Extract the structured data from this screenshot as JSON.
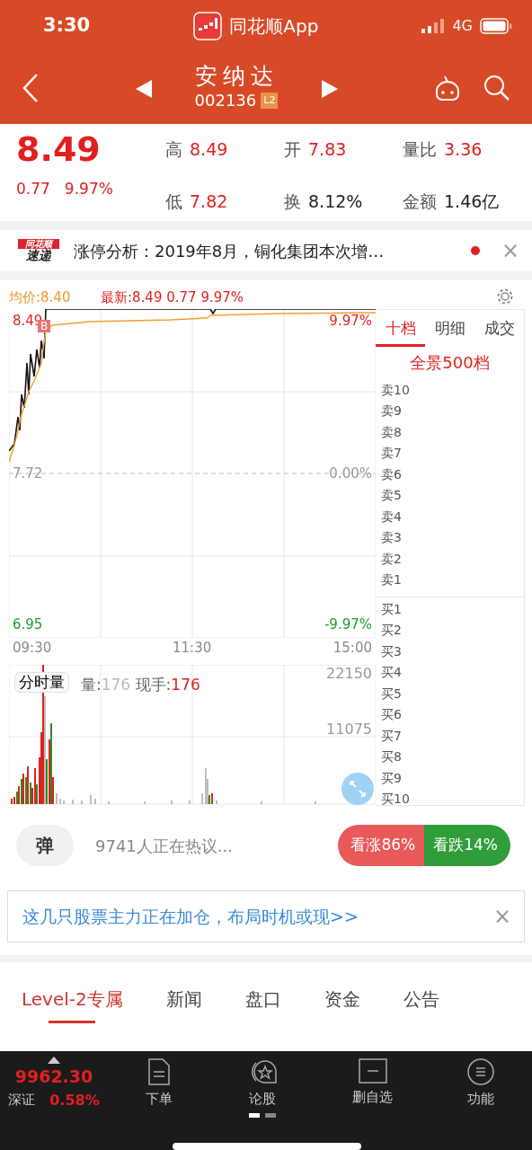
{
  "status_bar": {
    "time": "3:30",
    "app": "同花顺App",
    "network": "4G"
  },
  "header": {
    "title": "安纳达",
    "code": "002136",
    "badge": "L2"
  },
  "quote": {
    "price": "8.49",
    "change": "0.77",
    "percent": "9.97%",
    "stats": [
      {
        "label": "高",
        "value": "8.49",
        "kind": "up"
      },
      {
        "label": "开",
        "value": "7.83",
        "kind": "up"
      },
      {
        "label": "量比",
        "value": "3.36",
        "kind": "up"
      },
      {
        "label": "低",
        "value": "7.82",
        "kind": "up"
      },
      {
        "label": "换",
        "value": "8.12%",
        "kind": "flat"
      },
      {
        "label": "金额",
        "value": "1.46亿",
        "kind": "flat"
      }
    ]
  },
  "news": {
    "logo_top": "同花顺",
    "logo_bottom": "速递",
    "text": "涨停分析：2019年8月，铜化集团本次增…",
    "unread": true,
    "close": "×"
  },
  "chart": {
    "avg": "均价:8.40",
    "latest": "最新:8.49 0.77 9.97%",
    "marker": "B",
    "left_ticks": [
      "8.49",
      "7.72",
      "6.95"
    ],
    "right_ticks": [
      "9.97%",
      "0.00%",
      "-9.97%"
    ],
    "times": [
      "09:30",
      "11:30",
      "15:00"
    ]
  },
  "volume": {
    "button": "分时量",
    "vol_label": "量:",
    "vol_value": "176",
    "hand_label": "现手:",
    "hand_value": "176",
    "ticks": [
      "22150",
      "11075"
    ]
  },
  "orderbook": {
    "tabs": [
      {
        "label": "十档",
        "selected": true
      },
      {
        "label": "明细",
        "selected": false
      },
      {
        "label": "成交",
        "selected": false
      }
    ],
    "full": "全景500档",
    "asks": [
      "卖10",
      "卖9",
      "卖8",
      "卖7",
      "卖6",
      "卖5",
      "卖4",
      "卖3",
      "卖2",
      "卖1"
    ],
    "bids": [
      "买1",
      "买2",
      "买3",
      "买4",
      "买5",
      "买6",
      "买7",
      "买8",
      "买9",
      "买10"
    ]
  },
  "comment": {
    "icon": "弹",
    "text": "9741人正在热议...",
    "bull": "看涨86%",
    "bear": "看跌14%"
  },
  "ad": {
    "text": "这几只股票主力正在加仓，布局时机或现>>",
    "close": "×"
  },
  "tabs": [
    {
      "label": "Level-2专属",
      "selected": true
    },
    {
      "label": "新闻",
      "selected": false
    },
    {
      "label": "盘口",
      "selected": false
    },
    {
      "label": "资金",
      "selected": false
    },
    {
      "label": "公告",
      "selected": false
    }
  ],
  "bottom_nav": {
    "index_value": "9962.30",
    "index_name": "深证",
    "index_percent": "0.58%",
    "items": [
      {
        "label": "下单",
        "kind": "order"
      },
      {
        "label": "论股",
        "kind": "forum"
      },
      {
        "label": "删自选",
        "kind": "remove"
      },
      {
        "label": "功能",
        "kind": "menu"
      }
    ]
  }
}
